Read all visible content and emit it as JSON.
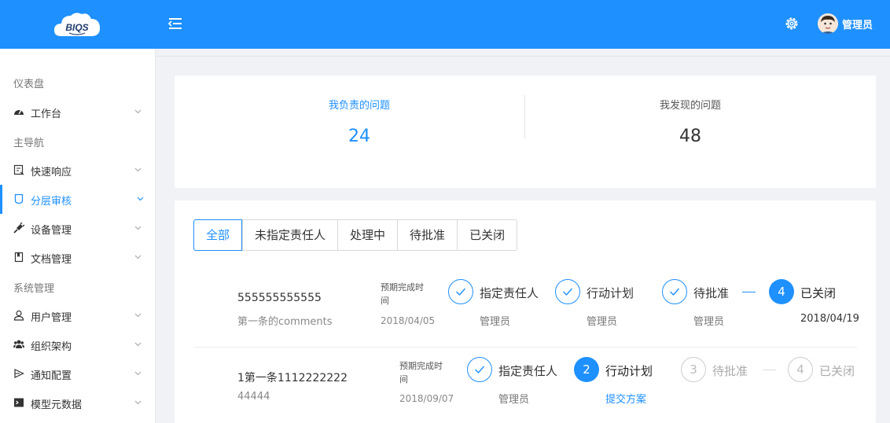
{
  "header": {
    "logo_text": "BIQS",
    "user_name": "管理员"
  },
  "sidebar": {
    "groups": [
      "仪表盘",
      "主导航",
      "系统管理"
    ],
    "items": [
      {
        "label": "工作台",
        "icon": "dashboard-icon"
      },
      {
        "label": "快速响应",
        "icon": "quick-response-icon"
      },
      {
        "label": "分层审核",
        "icon": "layered-audit-icon",
        "active": true
      },
      {
        "label": "设备管理",
        "icon": "plug-icon"
      },
      {
        "label": "文档管理",
        "icon": "book-icon"
      },
      {
        "label": "用户管理",
        "icon": "user-icon"
      },
      {
        "label": "组织架构",
        "icon": "group-icon"
      },
      {
        "label": "通知配置",
        "icon": "send-icon"
      },
      {
        "label": "模型元数据",
        "icon": "terminal-icon"
      }
    ]
  },
  "stats": {
    "mine_label": "我负责的问题",
    "mine_value": "24",
    "found_label": "我发现的问题",
    "found_value": "48"
  },
  "tabs": [
    "全部",
    "未指定责任人",
    "处理中",
    "待批准",
    "已关闭"
  ],
  "issues": [
    {
      "title": "555555555555",
      "comment": "第一条的comments",
      "due_label_1": "预期完成时",
      "due_label_2": "间",
      "due_date": "2018/04/05",
      "steps": [
        {
          "title": "指定责任人",
          "sub": "管理员",
          "state": "done"
        },
        {
          "title": "行动计划",
          "sub": "管理员",
          "state": "done"
        },
        {
          "title": "待批准",
          "sub": "管理员",
          "state": "done"
        },
        {
          "num": "4",
          "title": "已关闭",
          "sub": "2018/04/19",
          "state": "current"
        }
      ]
    },
    {
      "title": "1第一条1112222222",
      "comment": "44444",
      "due_label_1": "预期完成时",
      "due_label_2": "间",
      "due_date": "2018/09/07",
      "steps": [
        {
          "title": "指定责任人",
          "sub": "管理员",
          "state": "done"
        },
        {
          "num": "2",
          "title": "行动计划",
          "sub": "提交方案",
          "state": "current"
        },
        {
          "num": "3",
          "title": "待批准",
          "state": "wait"
        },
        {
          "num": "4",
          "title": "已关闭",
          "state": "wait"
        }
      ]
    }
  ],
  "colors": {
    "primary": "#1e90ff",
    "header_bg": "#1e90ff",
    "page_bg": "#f0f2f5",
    "done_line": "#1e90ff",
    "wait_line": "#dddddd"
  }
}
